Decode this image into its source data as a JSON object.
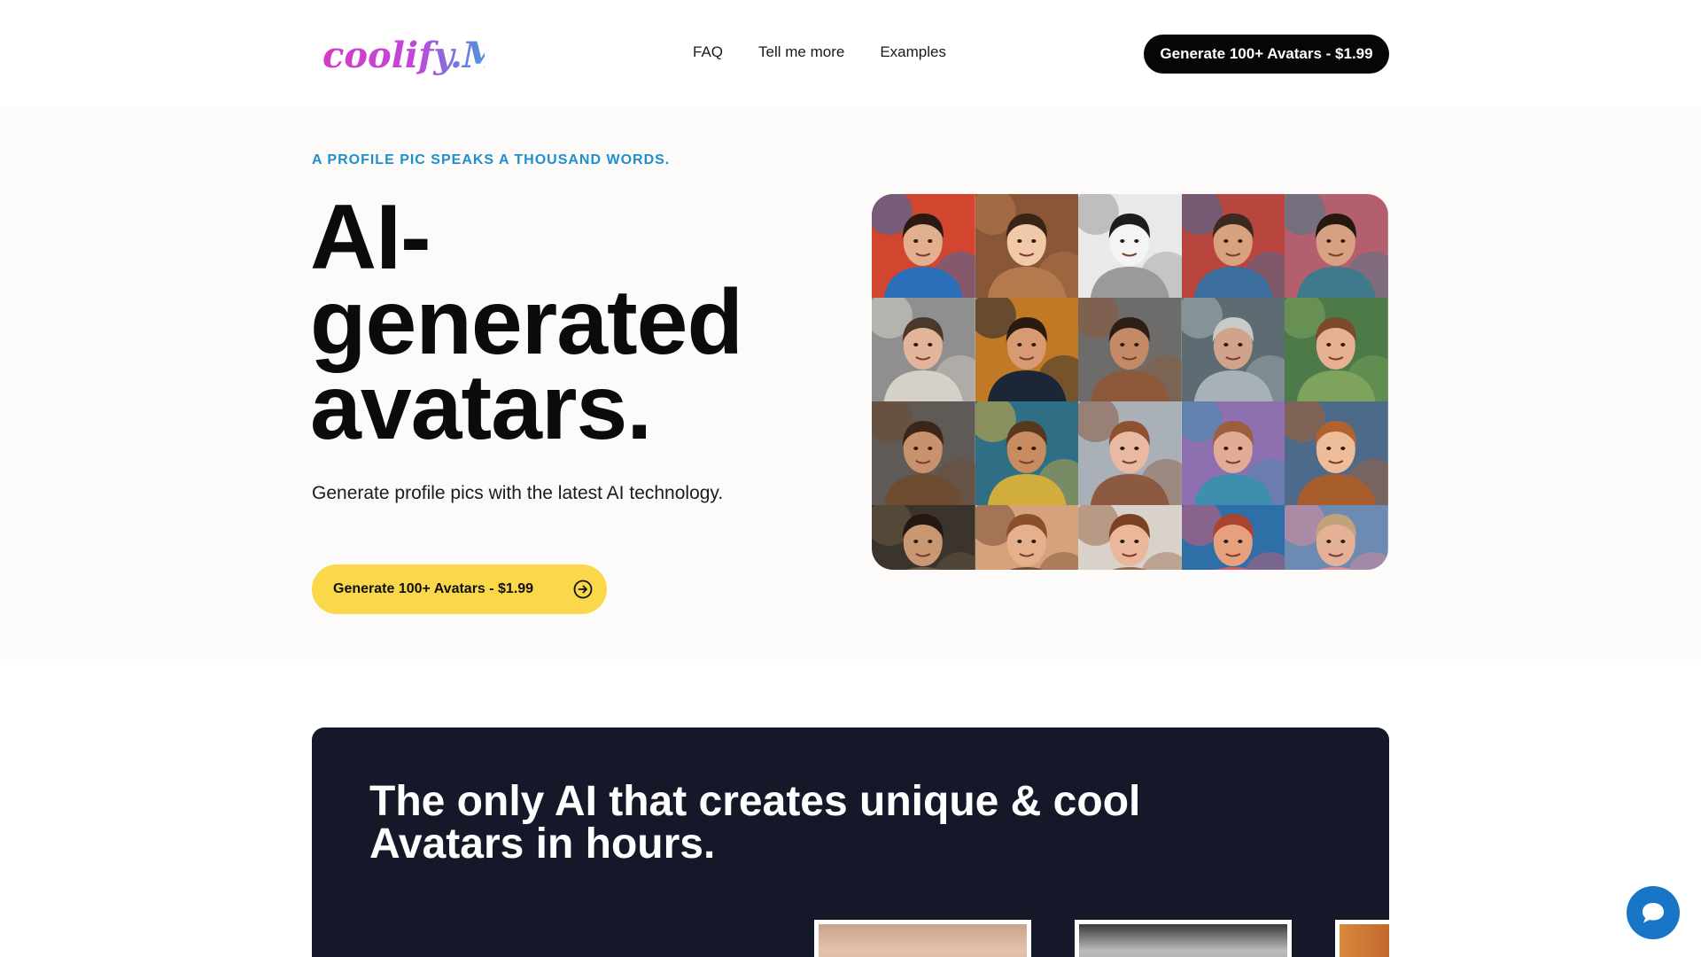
{
  "header": {
    "logo_alt": "coolify.Me",
    "nav": [
      {
        "label": "FAQ"
      },
      {
        "label": "Tell me more"
      },
      {
        "label": "Examples"
      }
    ],
    "cta_label": "Generate 100+ Avatars - $1.99"
  },
  "hero": {
    "eyebrow": "A PROFILE PIC SPEAKS A THOUSAND WORDS.",
    "headline_line1": "AI-",
    "headline_line2": "generated",
    "headline_line3": "avatars.",
    "subline": "Generate profile pics with the latest AI technology.",
    "cta_label": "Generate 100+ Avatars - $1.99",
    "cta_icon": "arrow-right-circle-icon"
  },
  "avatar_grid": {
    "tiles": [
      {
        "bg": "#d2452e",
        "accent": "#2a6fb8",
        "skin": "#e2b08e",
        "hair": "#2b1a12"
      },
      {
        "bg": "#8a5638",
        "accent": "#b47a4e",
        "skin": "#f1c9a8",
        "hair": "#3a2418"
      },
      {
        "bg": "#e9e9e9",
        "accent": "#9a9a9a",
        "skin": "#f4f4f4",
        "hair": "#1d1d1d"
      },
      {
        "bg": "#b8463f",
        "accent": "#3c6e9e",
        "skin": "#d9a27f",
        "hair": "#3a2a20"
      },
      {
        "bg": "#b45f6e",
        "accent": "#3f7a8c",
        "skin": "#d8a183",
        "hair": "#24180f"
      },
      {
        "bg": "#8f8f8f",
        "accent": "#d6d1c8",
        "skin": "#e2b59a",
        "hair": "#4a382b"
      },
      {
        "bg": "#c07924",
        "accent": "#1d2636",
        "skin": "#d79a72",
        "hair": "#2a1a10"
      },
      {
        "bg": "#6d6c6a",
        "accent": "#8c5a3a",
        "skin": "#c48a66",
        "hair": "#2e1f16"
      },
      {
        "bg": "#5c6c72",
        "accent": "#a8b2b6",
        "skin": "#cfa48a",
        "hair": "#c9c9c9"
      },
      {
        "bg": "#4e7a4a",
        "accent": "#7da35c",
        "skin": "#e6b193",
        "hair": "#7a4a2a"
      },
      {
        "bg": "#5f5a55",
        "accent": "#6e4c32",
        "skin": "#c8926c",
        "hair": "#3a261a"
      },
      {
        "bg": "#2f6f86",
        "accent": "#d1ad3e",
        "skin": "#c98c60",
        "hair": "#5a3820"
      },
      {
        "bg": "#aab0b8",
        "accent": "#8b5a40",
        "skin": "#e9b9a2",
        "hair": "#8e5231"
      },
      {
        "bg": "#8e6fb0",
        "accent": "#3e8fae",
        "skin": "#e2ab95",
        "hair": "#9c5e3c"
      },
      {
        "bg": "#4e6a8a",
        "accent": "#a85d2c",
        "skin": "#efbc9a",
        "hair": "#b1622f"
      },
      {
        "bg": "#3a342c",
        "accent": "#6a5a44",
        "skin": "#c99873",
        "hair": "#241810"
      },
      {
        "bg": "#d6a27a",
        "accent": "#7a4e36",
        "skin": "#e5b18d",
        "hair": "#8c4f2e"
      },
      {
        "bg": "#d9d2cb",
        "accent": "#9c6a4e",
        "skin": "#eab79b",
        "hair": "#7a4127"
      },
      {
        "bg": "#2e6fa8",
        "accent": "#d45a72",
        "skin": "#e7a07e",
        "hair": "#a9452c"
      },
      {
        "bg": "#6c8ab2",
        "accent": "#e08a9a",
        "skin": "#e4b197",
        "hair": "#c2a27a"
      }
    ]
  },
  "section2": {
    "title": "The only AI that creates unique & cool Avatars in hours."
  },
  "chat": {
    "icon": "chat-bubble-icon"
  },
  "colors": {
    "accent_blue": "#1e8fce",
    "cta_yellow": "#fbd74a",
    "dark_bg": "#141829",
    "chat_blue": "#1976c7"
  }
}
